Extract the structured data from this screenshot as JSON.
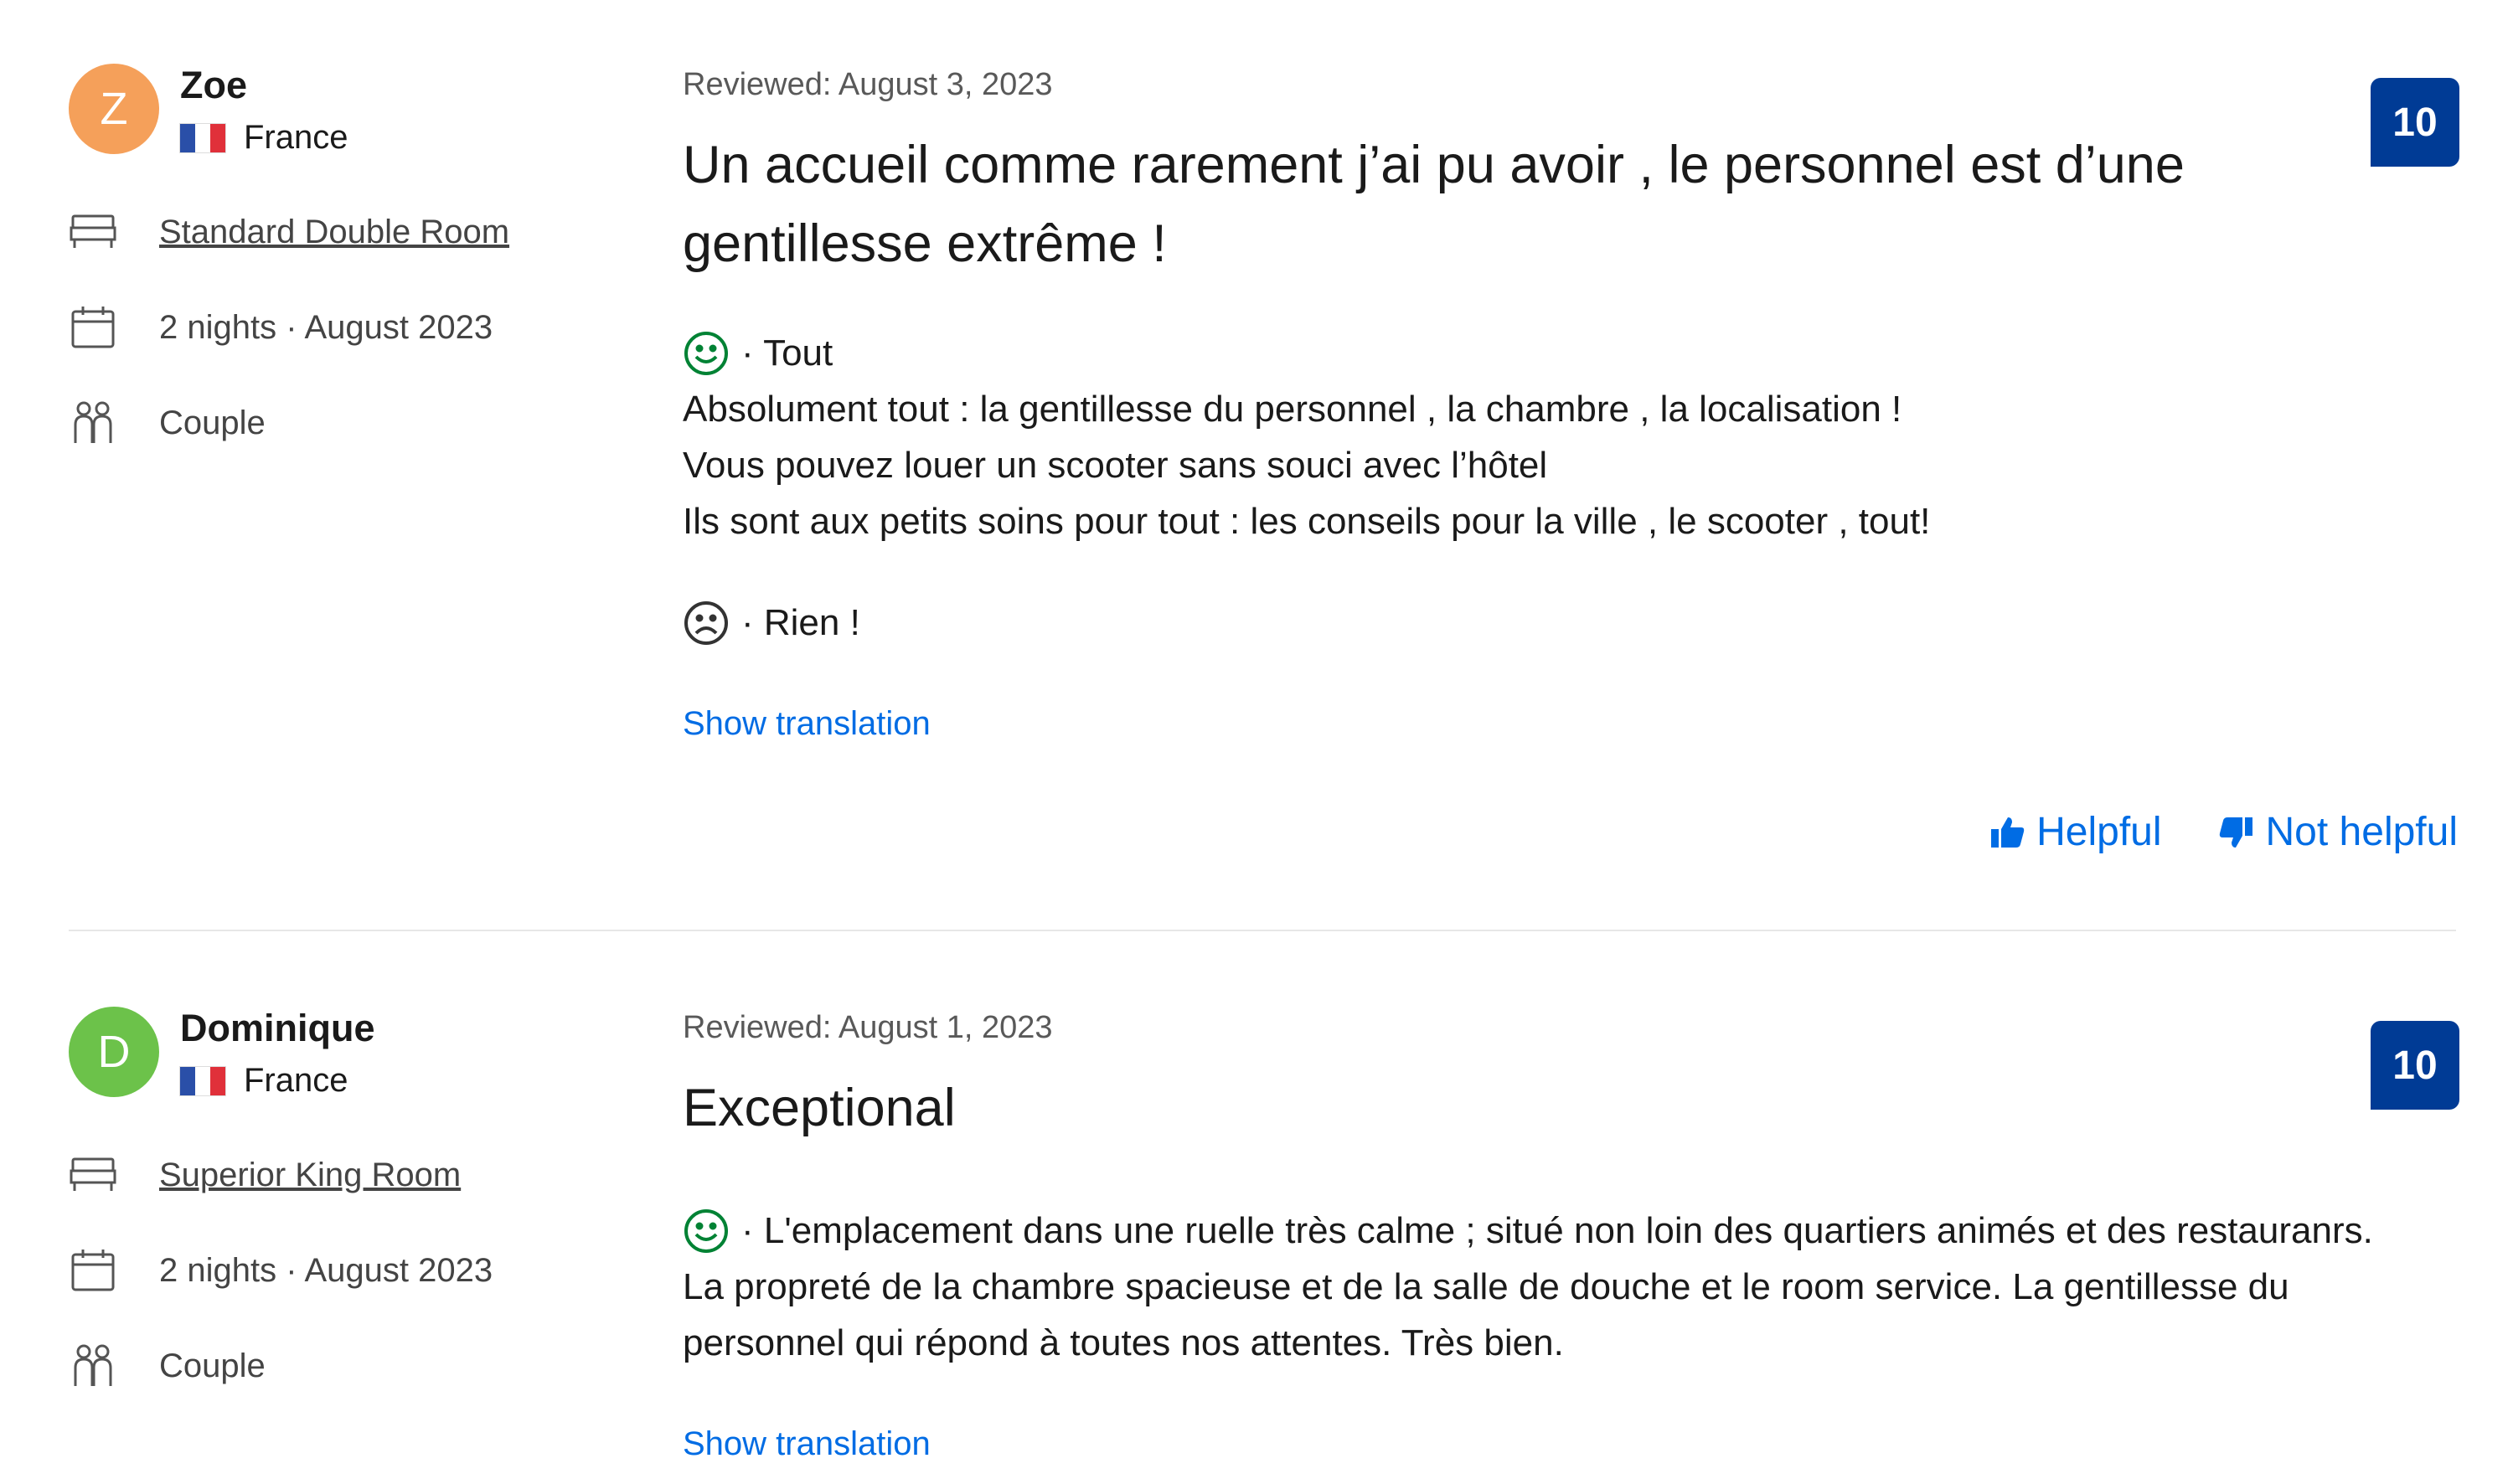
{
  "reviews": [
    {
      "avatar_letter": "Z",
      "avatar_color": "#f5a05a",
      "name": "Zoe",
      "country": "France",
      "room": "Standard Double Room",
      "stay": "2 nights ·  August 2023",
      "traveler_type": "Couple",
      "reviewed_date": "Reviewed: August 3, 2023",
      "score": "10",
      "title_line1": "Un accueil comme rarement j’ai pu avoir , le personnel est d’une",
      "title_line2": "gentillesse extrême !",
      "positive_label": "· Tout",
      "positive_lines": [
        "Absolument tout : la gentillesse du personnel , la chambre , la localisation !",
        "Vous pouvez louer un scooter sans souci avec l’hôtel",
        "Ils sont aux petits soins pour tout : les conseils pour la ville , le scooter , tout!"
      ],
      "negative_label": "· Rien !",
      "show_translation": "Show translation",
      "helpful": "Helpful",
      "not_helpful": "Not helpful"
    },
    {
      "avatar_letter": "D",
      "avatar_color": "#6cc24a",
      "name": "Dominique",
      "country": "France",
      "room": "Superior King Room",
      "stay": "2 nights ·  August 2023",
      "traveler_type": "Couple",
      "reviewed_date": "Reviewed: August 1, 2023",
      "score": "10",
      "title_line1": "Exceptional",
      "positive_lines": [
        "· L'emplacement dans une ruelle très calme ; situé non loin des quartiers animés et des restauranrs.",
        "La propreté de la chambre spacieuse et de la salle de douche et le room service. La gentillesse du",
        "personnel qui répond à toutes nos attentes. Très bien."
      ],
      "show_translation": "Show translation"
    }
  ],
  "icons": {
    "bed": "bed-icon",
    "calendar": "calendar-icon",
    "people": "people-icon",
    "positive": "smile-icon",
    "negative": "frown-icon",
    "thumb_up": "thumbs-up-icon",
    "thumb_down": "thumbs-down-icon"
  },
  "colors": {
    "score_bg": "#003b95",
    "link": "#006ce4",
    "positive": "#008234"
  }
}
